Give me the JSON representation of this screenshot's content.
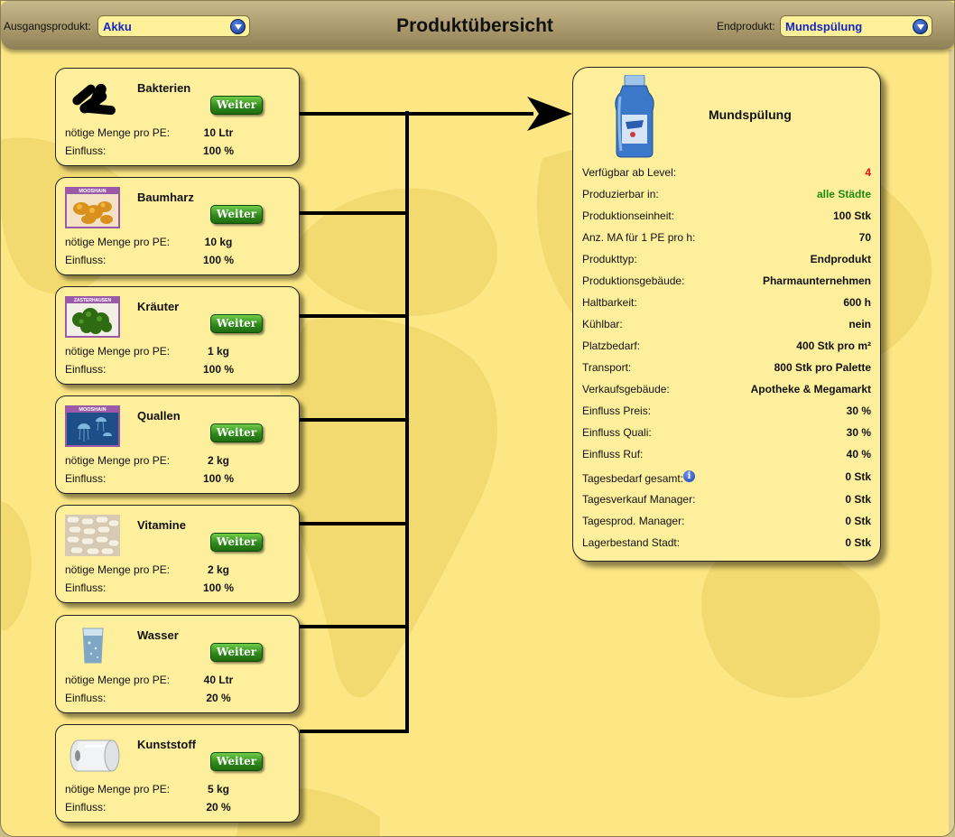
{
  "header": {
    "source_label": "Ausgangsprodukt:",
    "source_value": "Akku",
    "title": "Produktübersicht",
    "end_label": "Endprodukt:",
    "end_value": "Mundspülung"
  },
  "ingredients": [
    {
      "name": "Bakterien",
      "button": "Weiter",
      "menge_label": "nötige Menge pro PE:",
      "menge": "10 Ltr",
      "einfluss_label": "Einfluss:",
      "einfluss": "100 %",
      "icon": "bacteria-icon"
    },
    {
      "name": "Baumharz",
      "button": "Weiter",
      "menge_label": "nötige Menge pro PE:",
      "menge": "10 kg",
      "einfluss_label": "Einfluss:",
      "einfluss": "100 %",
      "icon": "resin-image",
      "tag": "MOOSHAIN"
    },
    {
      "name": "Kräuter",
      "button": "Weiter",
      "menge_label": "nötige Menge pro PE:",
      "menge": "1 kg",
      "einfluss_label": "Einfluss:",
      "einfluss": "100 %",
      "icon": "herbs-image",
      "tag": "ZASTERHAUSEN"
    },
    {
      "name": "Quallen",
      "button": "Weiter",
      "menge_label": "nötige Menge pro PE:",
      "menge": "2 kg",
      "einfluss_label": "Einfluss:",
      "einfluss": "100 %",
      "icon": "jellyfish-image",
      "tag": "MOOSHAIN"
    },
    {
      "name": "Vitamine",
      "button": "Weiter",
      "menge_label": "nötige Menge pro PE:",
      "menge": "2 kg",
      "einfluss_label": "Einfluss:",
      "einfluss": "100 %",
      "icon": "vitamins-image"
    },
    {
      "name": "Wasser",
      "button": "Weiter",
      "menge_label": "nötige Menge pro PE:",
      "menge": "40 Ltr",
      "einfluss_label": "Einfluss:",
      "einfluss": "20 %",
      "icon": "water-glass-icon"
    },
    {
      "name": "Kunststoff",
      "button": "Weiter",
      "menge_label": "nötige Menge pro PE:",
      "menge": "5 kg",
      "einfluss_label": "Einfluss:",
      "einfluss": "20 %",
      "icon": "plastic-roll-icon"
    }
  ],
  "end_product": {
    "name": "Mundspülung",
    "icon": "mouthwash-bottle-icon",
    "properties": [
      {
        "label": "Verfügbar ab Level:",
        "value": "4",
        "color": "#e01010"
      },
      {
        "label": "Produzierbar in:",
        "value": "alle Städte",
        "color": "#1f8a12"
      },
      {
        "label": "Produktionseinheit:",
        "value": "100 Stk"
      },
      {
        "label": "Anz. MA für 1 PE pro h:",
        "value": "70"
      },
      {
        "label": "Produkttyp:",
        "value": "Endprodukt"
      },
      {
        "label": "Produktionsgebäude:",
        "value": "Pharmaunternehmen"
      },
      {
        "label": "Haltbarkeit:",
        "value": "600 h"
      },
      {
        "label": "Kühlbar:",
        "value": "nein"
      },
      {
        "label": "Platzbedarf:",
        "value": "400 Stk pro m²"
      },
      {
        "label": "Transport:",
        "value": "800 Stk pro Palette"
      },
      {
        "label": "Verkaufsgebäude:",
        "value": "Apotheke & Megamarkt"
      },
      {
        "label": "Einfluss Preis:",
        "value": "30 %"
      },
      {
        "label": "Einfluss Quali:",
        "value": "30 %"
      },
      {
        "label": "Einfluss Ruf:",
        "value": "40 %"
      },
      {
        "label": "Tagesbedarf gesamt:",
        "value": "0 Stk",
        "info": "i"
      },
      {
        "label": "Tagesverkauf Manager:",
        "value": "0 Stk"
      },
      {
        "label": "Tagesprod. Manager:",
        "value": "0 Stk"
      },
      {
        "label": "Lagerbestand Stadt:",
        "value": "0 Stk"
      }
    ]
  },
  "colors": {
    "background": "#fde784",
    "card": "#feef9c",
    "button": "#2f8c1a",
    "select_text": "#1526c0"
  }
}
